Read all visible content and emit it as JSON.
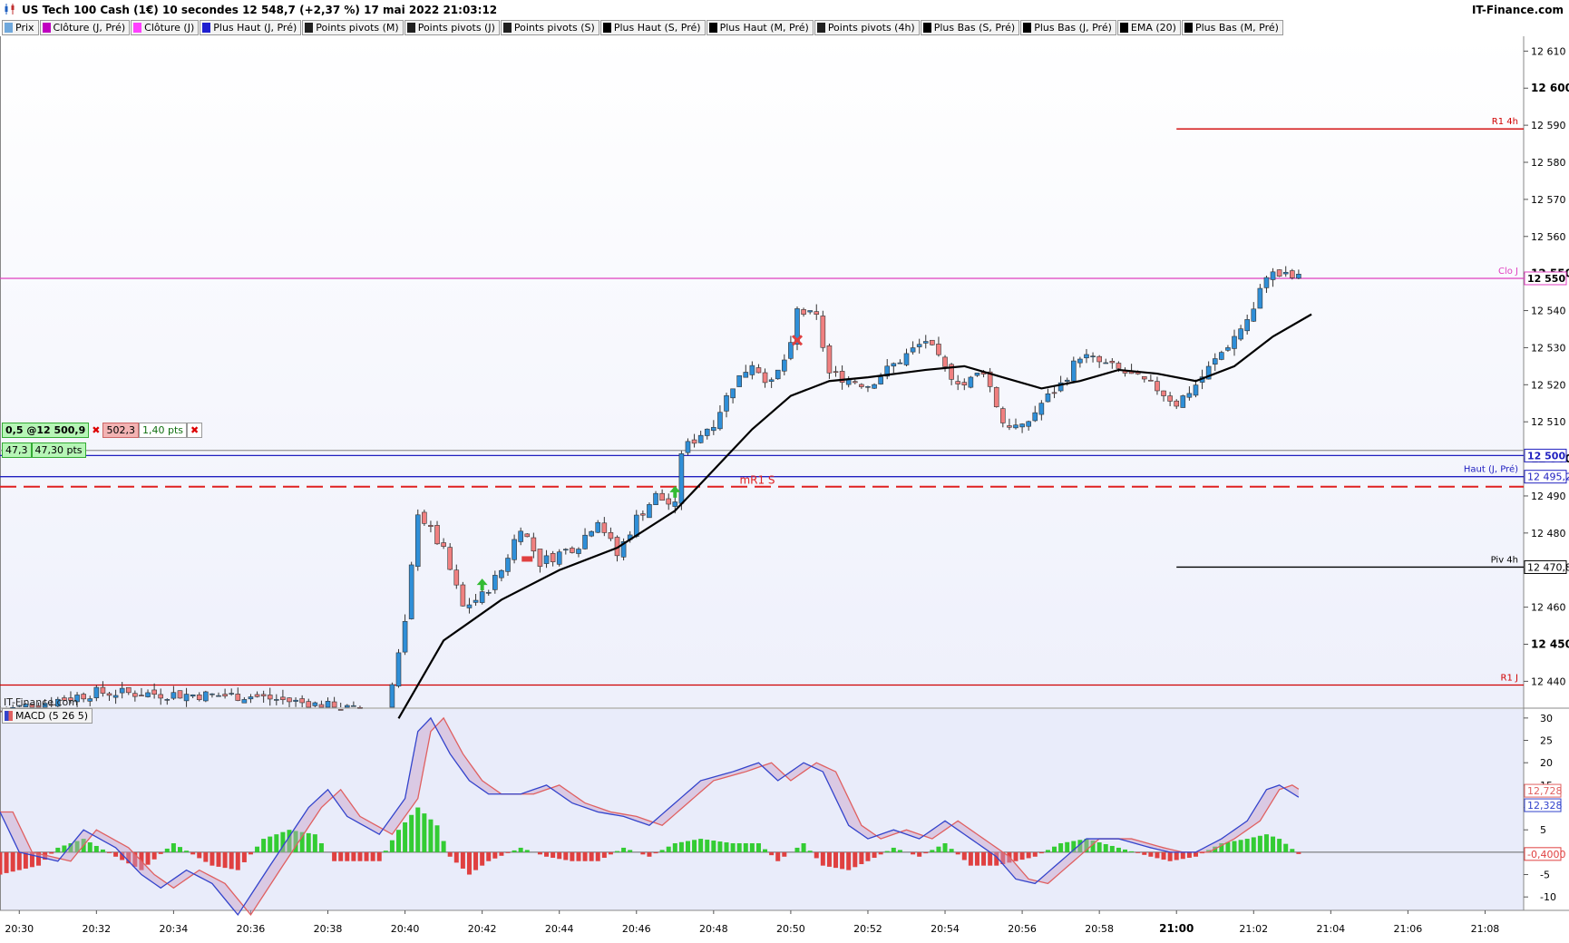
{
  "header": {
    "title": "US Tech 100 Cash (1€) 10 secondes 12 548,7 (+2,37 %) 17 mai 2022 21:03:12",
    "logo": "IT-Finance.com"
  },
  "legend": [
    {
      "label": "Prix",
      "color": "#6fa8dc"
    },
    {
      "label": "Clôture (J, Pré)",
      "color": "#c000c0"
    },
    {
      "label": "Clôture (J)",
      "color": "#ff40ff"
    },
    {
      "label": "Plus Haut (J, Pré)",
      "color": "#2020d0"
    },
    {
      "label": "Points pivots (M)",
      "color": "#202020"
    },
    {
      "label": "Points pivots (J)",
      "color": "#202020"
    },
    {
      "label": "Points pivots (S)",
      "color": "#202020"
    },
    {
      "label": "Plus Haut (S, Pré)",
      "color": "#000000"
    },
    {
      "label": "Plus Haut (M, Pré)",
      "color": "#000000"
    },
    {
      "label": "Points pivots (4h)",
      "color": "#202020"
    },
    {
      "label": "Plus Bas (S, Pré)",
      "color": "#000000"
    },
    {
      "label": "Plus Bas (J, Pré)",
      "color": "#000000"
    },
    {
      "label": "EMA (20)",
      "color": "#000000"
    },
    {
      "label": "Plus Bas (M, Pré)",
      "color": "#000000"
    }
  ],
  "orders": {
    "qty_price": "0,5 @12 500,9",
    "close_price": "502,3",
    "spread": "1,40 pts",
    "pos_a": "47,3",
    "pos_b": "47,30 pts"
  },
  "watermark": "IT-Finance.com",
  "macd_legend": "MACD (5 26 5)",
  "colors": {
    "up": "#2f8fd8",
    "down": "#f08080",
    "ema": "#000000",
    "r1": "#d00000",
    "close_j": "#e040c0",
    "high_j": "#2020c0",
    "hist_up": "#33cc33",
    "hist_down": "#e04040",
    "macd_line": "#3344cc",
    "signal_line": "#e06060",
    "bg_main": "#eef0fb",
    "bg_macd": "#e9ecfa"
  },
  "chart_data": {
    "type": "candlestick",
    "price_axis": {
      "ticks": [
        "12 610",
        "12 600",
        "12 590",
        "12 580",
        "12 570",
        "12 560",
        "12 550",
        "12 540",
        "12 530",
        "12 520",
        "12 510",
        "12 500",
        "12 490",
        "12 480",
        "12 470",
        "12 460",
        "12 450",
        "12 440"
      ],
      "bold_ticks": [
        "12 600",
        "12 550",
        "12 500",
        "12 450"
      ],
      "ylim": [
        12433,
        12614
      ]
    },
    "time_axis": {
      "ticks": [
        "20:30",
        "20:32",
        "20:34",
        "20:36",
        "20:38",
        "20:40",
        "20:42",
        "20:44",
        "20:46",
        "20:48",
        "20:50",
        "20:52",
        "20:54",
        "20:56",
        "20:58",
        "21:00",
        "21:02",
        "21:04",
        "21:06",
        "21:08"
      ],
      "bold_ticks": [
        "21:00"
      ],
      "range": [
        "20:29:30",
        "21:09:00"
      ]
    },
    "levels": [
      {
        "label": "R1 4h",
        "value": 12589,
        "color": "#d00000",
        "from": "21:00:00",
        "axis_tag": ""
      },
      {
        "label": "Clo J",
        "value": 12548.7,
        "color": "#e040c0",
        "from": "20:29:30",
        "axis_tag": "12 550"
      },
      {
        "label": "",
        "value": 12502.3,
        "color": "#a0a0a0",
        "from": "20:29:30",
        "axis_tag": ""
      },
      {
        "label": "",
        "value": 12500.9,
        "color": "#2020c0",
        "from": "20:29:30",
        "axis_tag": "12 500"
      },
      {
        "label": "Haut (J, Pré)",
        "value": 12495.2,
        "color": "#2020c0",
        "from": "20:29:30",
        "axis_tag": "12 495,2"
      },
      {
        "label": "mR1 S",
        "value": 12492.5,
        "color": "#e02020",
        "from": "20:29:30",
        "dashed": true,
        "axis_tag": ""
      },
      {
        "label": "Piv 4h",
        "value": 12470.8,
        "color": "#000000",
        "from": "21:00:00",
        "axis_tag": "12 470,8"
      },
      {
        "label": "R1 J",
        "value": 12439,
        "color": "#d00000",
        "from": "20:29:30",
        "axis_tag": ""
      }
    ],
    "ohlc_keypoints": [
      [
        "20:29:30",
        12432
      ],
      [
        "20:31:30",
        12436
      ],
      [
        "20:32:00",
        12437
      ],
      [
        "20:36:00",
        12436
      ],
      [
        "20:37:30",
        12434
      ],
      [
        "20:39:30",
        12431
      ],
      [
        "20:40:00",
        12455
      ],
      [
        "20:40:20",
        12486
      ],
      [
        "20:41:00",
        12475
      ],
      [
        "20:41:30",
        12460
      ],
      [
        "20:42:00",
        12463
      ],
      [
        "20:42:30",
        12470
      ],
      [
        "20:43:00",
        12482
      ],
      [
        "20:43:30",
        12472
      ],
      [
        "20:44:30",
        12477
      ],
      [
        "20:45:00",
        12484
      ],
      [
        "20:45:30",
        12474
      ],
      [
        "20:46:00",
        12484
      ],
      [
        "20:46:30",
        12490
      ],
      [
        "20:47:00",
        12487
      ],
      [
        "20:47:10",
        12502
      ],
      [
        "20:48:00",
        12510
      ],
      [
        "20:48:30",
        12520
      ],
      [
        "20:49:00",
        12526
      ],
      [
        "20:49:30",
        12520
      ],
      [
        "20:50:00",
        12530
      ],
      [
        "20:50:10",
        12540
      ],
      [
        "20:50:40",
        12538
      ],
      [
        "20:51:00",
        12523
      ],
      [
        "20:52:00",
        12520
      ],
      [
        "20:52:30",
        12524
      ],
      [
        "20:53:30",
        12532
      ],
      [
        "20:54:00",
        12524
      ],
      [
        "20:54:30",
        12520
      ],
      [
        "20:55:00",
        12524
      ],
      [
        "20:55:30",
        12510
      ],
      [
        "20:56:00",
        12508
      ],
      [
        "20:56:30",
        12515
      ],
      [
        "20:57:00",
        12520
      ],
      [
        "20:57:30",
        12528
      ],
      [
        "20:58:30",
        12524
      ],
      [
        "20:59:30",
        12519
      ],
      [
        "21:00:00",
        12515
      ],
      [
        "21:00:30",
        12520
      ],
      [
        "21:01:30",
        12533
      ],
      [
        "21:02:00",
        12540
      ],
      [
        "21:02:20",
        12550
      ],
      [
        "21:03:10",
        12548.7
      ]
    ],
    "ema20_keypoints": [
      [
        "20:39:50",
        12430
      ],
      [
        "20:41:00",
        12451
      ],
      [
        "20:42:30",
        12462
      ],
      [
        "20:44:00",
        12470
      ],
      [
        "20:45:30",
        12476
      ],
      [
        "20:47:00",
        12486
      ],
      [
        "20:48:00",
        12497
      ],
      [
        "20:49:00",
        12508
      ],
      [
        "20:50:00",
        12517
      ],
      [
        "20:51:00",
        12521
      ],
      [
        "20:52:00",
        12522
      ],
      [
        "20:53:30",
        12524
      ],
      [
        "20:54:30",
        12525
      ],
      [
        "20:55:30",
        12522
      ],
      [
        "20:56:30",
        12519
      ],
      [
        "20:57:30",
        12521
      ],
      [
        "20:58:30",
        12524
      ],
      [
        "20:59:30",
        12523
      ],
      [
        "21:00:30",
        12521
      ],
      [
        "21:01:30",
        12525
      ],
      [
        "21:02:30",
        12533
      ],
      [
        "21:03:30",
        12539
      ]
    ],
    "markers": [
      {
        "type": "buy-arrow",
        "time": "20:42:00",
        "value": 12466
      },
      {
        "type": "sell-rect",
        "time": "20:43:10",
        "value": 12473
      },
      {
        "type": "buy-arrow",
        "time": "20:47:00",
        "value": 12491
      },
      {
        "type": "cross",
        "time": "20:50:10",
        "value": 12532
      }
    ],
    "macd": {
      "ticks": [
        "30",
        "25",
        "20",
        "15",
        "10",
        "5",
        "-5",
        "-10"
      ],
      "ylim": [
        -13,
        32
      ],
      "values_tags": [
        "12,728",
        "12,328",
        "-0,4000"
      ],
      "macd_keypoints": [
        [
          "20:29:30",
          9
        ],
        [
          "20:30:00",
          0
        ],
        [
          "20:31:00",
          -2
        ],
        [
          "20:31:40",
          5
        ],
        [
          "20:32:30",
          1
        ],
        [
          "20:33:10",
          -5
        ],
        [
          "20:33:40",
          -8
        ],
        [
          "20:34:20",
          -4
        ],
        [
          "20:35:00",
          -7
        ],
        [
          "20:35:40",
          -14
        ],
        [
          "20:36:30",
          -3
        ],
        [
          "20:37:30",
          10
        ],
        [
          "20:38:00",
          14
        ],
        [
          "20:38:30",
          8
        ],
        [
          "20:39:20",
          4
        ],
        [
          "20:40:00",
          12
        ],
        [
          "20:40:20",
          27
        ],
        [
          "20:40:40",
          30
        ],
        [
          "20:41:10",
          22
        ],
        [
          "20:41:40",
          16
        ],
        [
          "20:42:10",
          13
        ],
        [
          "20:43:00",
          13
        ],
        [
          "20:43:40",
          15
        ],
        [
          "20:44:20",
          11
        ],
        [
          "20:45:00",
          9
        ],
        [
          "20:45:40",
          8
        ],
        [
          "20:46:20",
          6
        ],
        [
          "20:47:00",
          11
        ],
        [
          "20:47:40",
          16
        ],
        [
          "20:48:30",
          18
        ],
        [
          "20:49:10",
          20
        ],
        [
          "20:49:40",
          16
        ],
        [
          "20:50:20",
          20
        ],
        [
          "20:50:50",
          18
        ],
        [
          "20:51:30",
          6
        ],
        [
          "20:52:00",
          3
        ],
        [
          "20:52:40",
          5
        ],
        [
          "20:53:20",
          3
        ],
        [
          "20:54:00",
          7
        ],
        [
          "20:54:40",
          3
        ],
        [
          "20:55:20",
          -1
        ],
        [
          "20:55:50",
          -6
        ],
        [
          "20:56:20",
          -7
        ],
        [
          "20:57:00",
          -2
        ],
        [
          "20:57:40",
          3
        ],
        [
          "20:58:30",
          3
        ],
        [
          "20:59:20",
          1
        ],
        [
          "20:59:50",
          0
        ],
        [
          "21:00:30",
          0
        ],
        [
          "21:01:10",
          3
        ],
        [
          "21:01:50",
          7
        ],
        [
          "21:02:20",
          14
        ],
        [
          "21:02:40",
          15
        ],
        [
          "21:03:10",
          12.3
        ]
      ],
      "signal_lag_seconds": 20,
      "histogram_keypoints": [
        [
          "20:29:30",
          -5
        ],
        [
          "20:30:30",
          -3
        ],
        [
          "20:31:00",
          1
        ],
        [
          "20:31:40",
          3
        ],
        [
          "20:32:30",
          -1
        ],
        [
          "20:33:10",
          -4
        ],
        [
          "20:34:00",
          2
        ],
        [
          "20:35:00",
          -3
        ],
        [
          "20:35:40",
          -4
        ],
        [
          "20:36:20",
          3
        ],
        [
          "20:37:00",
          5
        ],
        [
          "20:37:40",
          4
        ],
        [
          "20:38:10",
          -2
        ],
        [
          "20:39:20",
          -2
        ],
        [
          "20:39:50",
          5
        ],
        [
          "20:40:20",
          10
        ],
        [
          "20:40:50",
          6
        ],
        [
          "20:41:10",
          -1
        ],
        [
          "20:41:40",
          -5
        ],
        [
          "20:42:10",
          -2
        ],
        [
          "20:43:00",
          1
        ],
        [
          "20:43:40",
          -1
        ],
        [
          "20:44:20",
          -2
        ],
        [
          "20:45:00",
          -2
        ],
        [
          "20:45:40",
          1
        ],
        [
          "20:46:20",
          -1
        ],
        [
          "20:47:00",
          2
        ],
        [
          "20:47:40",
          3
        ],
        [
          "20:48:30",
          2
        ],
        [
          "20:49:10",
          2
        ],
        [
          "20:49:40",
          -2
        ],
        [
          "20:50:20",
          2
        ],
        [
          "20:50:50",
          -3
        ],
        [
          "20:51:30",
          -4
        ],
        [
          "20:52:00",
          -2
        ],
        [
          "20:52:40",
          1
        ],
        [
          "20:53:20",
          -1
        ],
        [
          "20:54:00",
          2
        ],
        [
          "20:54:40",
          -3
        ],
        [
          "20:55:20",
          -3
        ],
        [
          "20:55:50",
          -2
        ],
        [
          "20:56:20",
          -1
        ],
        [
          "20:57:00",
          2
        ],
        [
          "20:57:40",
          3
        ],
        [
          "20:58:30",
          1
        ],
        [
          "20:59:20",
          -1
        ],
        [
          "20:59:50",
          -2
        ],
        [
          "21:00:30",
          -1
        ],
        [
          "21:01:10",
          2
        ],
        [
          "21:01:50",
          3
        ],
        [
          "21:02:20",
          4
        ],
        [
          "21:02:40",
          3
        ],
        [
          "21:03:10",
          -0.4
        ]
      ]
    }
  }
}
